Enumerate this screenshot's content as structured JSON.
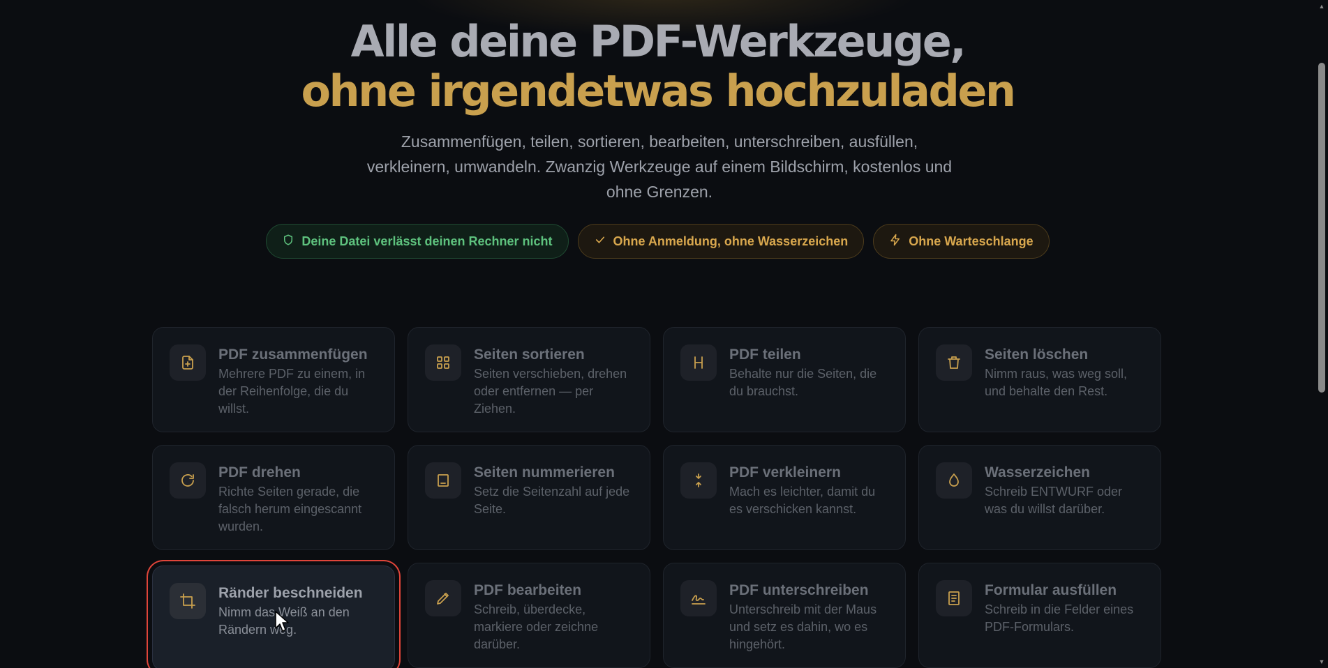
{
  "hero": {
    "title_line1": "Alle deine PDF-Werkzeuge,",
    "title_line2": "ohne irgendetwas hochzuladen",
    "subtitle": "Zusammenfügen, teilen, sortieren, bearbeiten, unterschreiben, ausfüllen, verkleinern, umwandeln. Zwanzig Werkzeuge auf einem Bildschirm, kostenlos und ohne Grenzen."
  },
  "badges": [
    {
      "label": "Deine Datei verlässt deinen Rechner nicht",
      "icon": "shield-icon",
      "color": "#5ec27e"
    },
    {
      "label": "Ohne Anmeldung, ohne Wasserzeichen",
      "icon": "check-icon",
      "color": "#d9a84e"
    },
    {
      "label": "Ohne Warteschlange",
      "icon": "lightning-icon",
      "color": "#d9a84e"
    }
  ],
  "tools": [
    {
      "title": "PDF zusammenfügen",
      "desc": "Mehrere PDF zu einem, in der Reihenfolge, die du willst.",
      "icon": "file-plus-icon"
    },
    {
      "title": "Seiten sortieren",
      "desc": "Seiten verschieben, drehen oder entfernen — per Ziehen.",
      "icon": "grid-icon"
    },
    {
      "title": "PDF teilen",
      "desc": "Behalte nur die Seiten, die du brauchst.",
      "icon": "split-icon"
    },
    {
      "title": "Seiten löschen",
      "desc": "Nimm raus, was weg soll, und behalte den Rest.",
      "icon": "trash-icon"
    },
    {
      "title": "PDF drehen",
      "desc": "Richte Seiten gerade, die falsch herum eingescannt wurden.",
      "icon": "rotate-icon"
    },
    {
      "title": "Seiten nummerieren",
      "desc": "Setz die Seitenzahl auf jede Seite.",
      "icon": "page-number-icon"
    },
    {
      "title": "PDF verkleinern",
      "desc": "Mach es leichter, damit du es verschicken kannst.",
      "icon": "compress-icon"
    },
    {
      "title": "Wasserzeichen",
      "desc": "Schreib ENTWURF oder was du willst darüber.",
      "icon": "droplet-icon"
    },
    {
      "title": "Ränder beschneiden",
      "desc": "Nimm das Weiß an den Rändern weg.",
      "icon": "crop-icon"
    },
    {
      "title": "PDF bearbeiten",
      "desc": "Schreib, überdecke, markiere oder zeichne darüber.",
      "icon": "pencil-icon"
    },
    {
      "title": "PDF unterschreiben",
      "desc": "Unterschreib mit der Maus und setz es dahin, wo es hingehört.",
      "icon": "signature-icon"
    },
    {
      "title": "Formular ausfüllen",
      "desc": "Schreib in die Felder eines PDF-Formulars.",
      "icon": "form-icon"
    }
  ],
  "colors": {
    "accent": "#c9a04e",
    "highlight_border": "#e0453a"
  }
}
